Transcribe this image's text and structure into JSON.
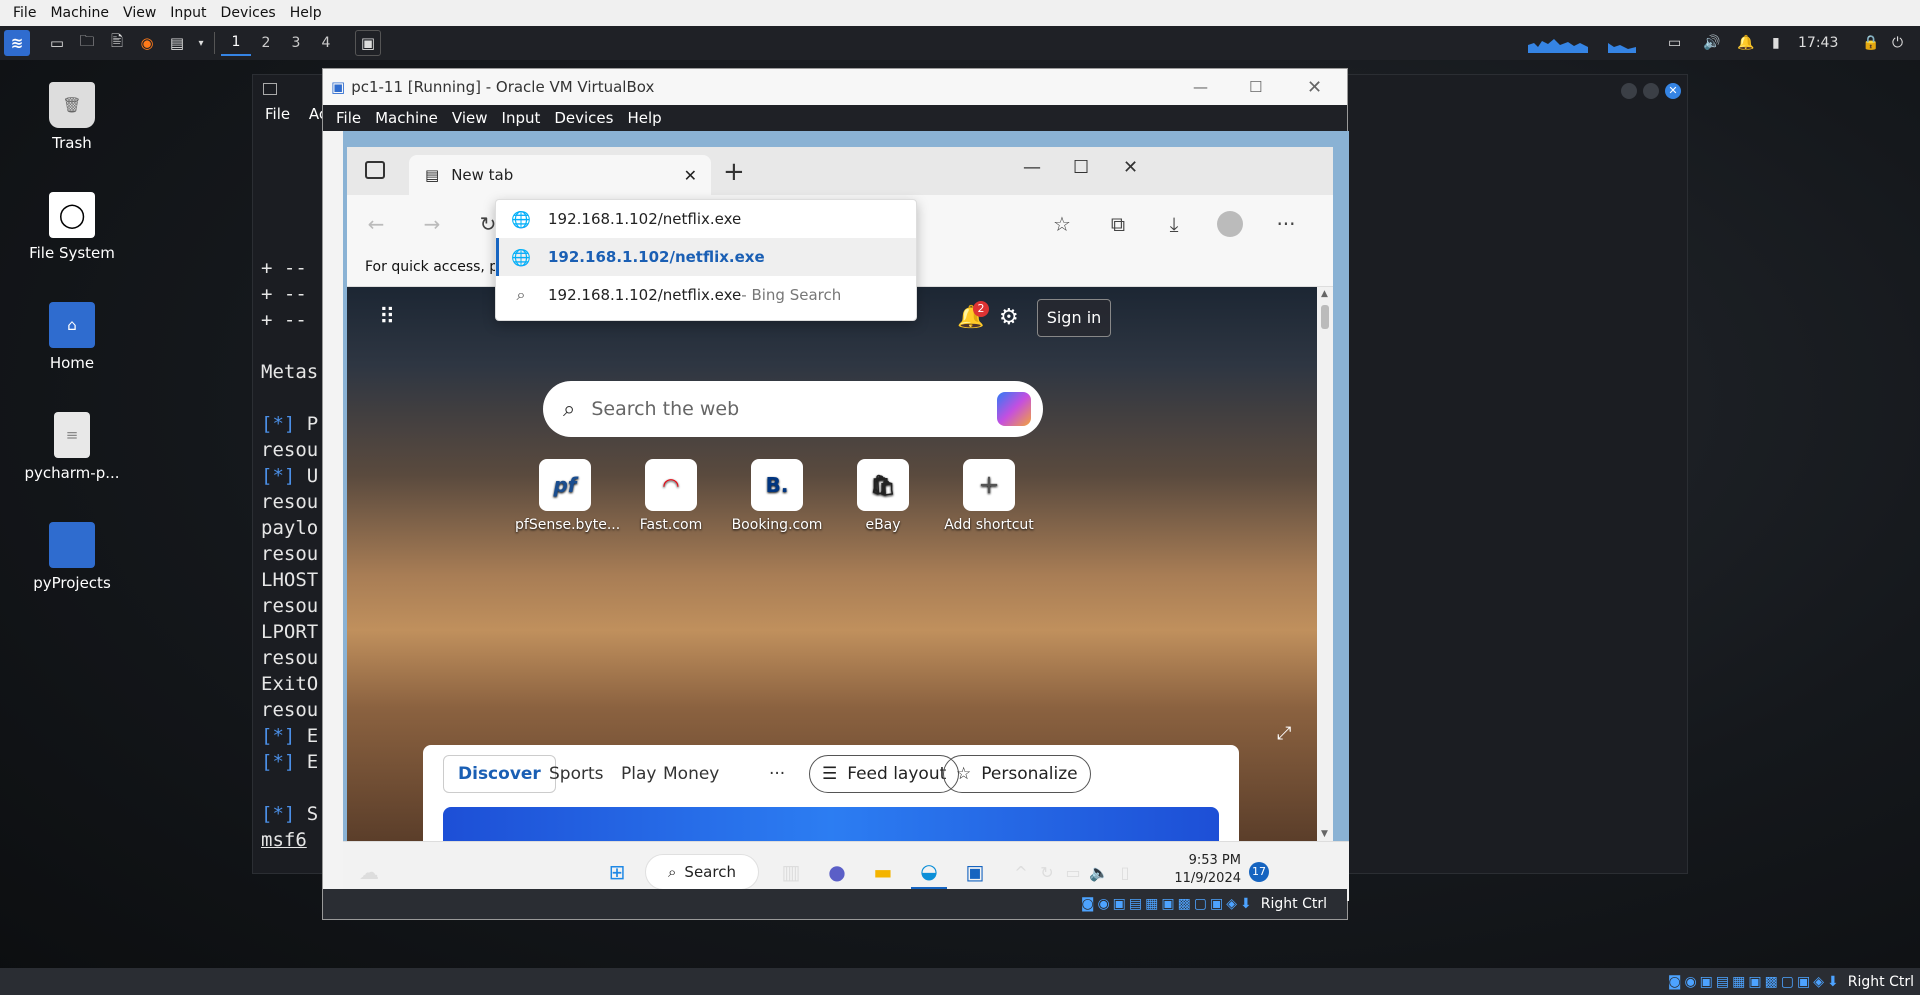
{
  "host_menubar": {
    "items": [
      "File",
      "Machine",
      "View",
      "Input",
      "Devices",
      "Help"
    ]
  },
  "kali_panel": {
    "workspaces": [
      "1",
      "2",
      "3",
      "4"
    ],
    "time": "17:43"
  },
  "desktop_icons": [
    {
      "label": "Trash",
      "icon": "trash-icon"
    },
    {
      "label": "File System",
      "icon": "drive-icon"
    },
    {
      "label": "Home",
      "icon": "home-folder-icon"
    },
    {
      "label": "pycharm-p...",
      "icon": "text-file-icon"
    },
    {
      "label": "pyProjects",
      "icon": "folder-icon"
    }
  ],
  "terminal": {
    "menu": [
      "File",
      "Ac"
    ],
    "lines": [
      {
        "prefix": "",
        "text": "+ --"
      },
      {
        "prefix": "",
        "text": "+ --"
      },
      {
        "prefix": "",
        "text": "+ --"
      },
      {
        "prefix": "",
        "text": ""
      },
      {
        "prefix": "",
        "text": "Metas"
      },
      {
        "prefix": "",
        "text": ""
      },
      {
        "prefix": "[*]",
        "text": " P"
      },
      {
        "prefix": "",
        "text": "resou"
      },
      {
        "prefix": "[*]",
        "text": " U"
      },
      {
        "prefix": "",
        "text": "resou"
      },
      {
        "prefix": "",
        "text": "paylo"
      },
      {
        "prefix": "",
        "text": "resou"
      },
      {
        "prefix": "",
        "text": "LHOST"
      },
      {
        "prefix": "",
        "text": "resou"
      },
      {
        "prefix": "",
        "text": "LPORT"
      },
      {
        "prefix": "",
        "text": "resou"
      },
      {
        "prefix": "",
        "text": "ExitO"
      },
      {
        "prefix": "",
        "text": "resou"
      },
      {
        "prefix": "[*]",
        "text": " E"
      },
      {
        "prefix": "[*]",
        "text": " E"
      },
      {
        "prefix": "",
        "text": ""
      },
      {
        "prefix": "[*]",
        "text": " S"
      },
      {
        "prefix": "",
        "text": "msf6",
        "underline": true
      }
    ]
  },
  "vbox": {
    "title": "pc1-11 [Running] - Oracle VM VirtualBox",
    "menu": [
      "File",
      "Machine",
      "View",
      "Input",
      "Devices",
      "Help"
    ],
    "status_right": "Right Ctrl"
  },
  "edge": {
    "tab_title": "New tab",
    "favorites_text": "For quick access, place y",
    "omnibox": {
      "input": "192.168.1.102/netflix.exe",
      "suggestion_bold": "192.168.1.102/netflix.exe",
      "search_query": "192.168.1.102/netflix.exe",
      "search_suffix": " - Bing Search"
    },
    "notification_count": "2",
    "sign_in": "Sign in",
    "search_placeholder": "Search the web",
    "shortcuts": [
      {
        "label": "pfSense.byte...",
        "glyph": "pf",
        "color": "#1a4d8f"
      },
      {
        "label": "Fast.com",
        "glyph": "◠",
        "color": "#e50914"
      },
      {
        "label": "Booking.com",
        "glyph": "B.",
        "color": "#003580"
      },
      {
        "label": "eBay",
        "glyph": "🛍",
        "color": "#222"
      },
      {
        "label": "Add shortcut",
        "glyph": "+",
        "color": "#555"
      }
    ],
    "feed_tabs": [
      "Discover",
      "Sports",
      "Play",
      "Money",
      "···"
    ],
    "feed_layout": "Feed layout",
    "personalize": "Personalize"
  },
  "windows_taskbar": {
    "search": "Search",
    "time": "9:53 PM",
    "date": "11/9/2024",
    "badge": "17"
  },
  "host_status": {
    "right": "Right Ctrl"
  },
  "colors": {
    "accent": "#1a5fb4",
    "kali_blue": "#3584e4"
  }
}
